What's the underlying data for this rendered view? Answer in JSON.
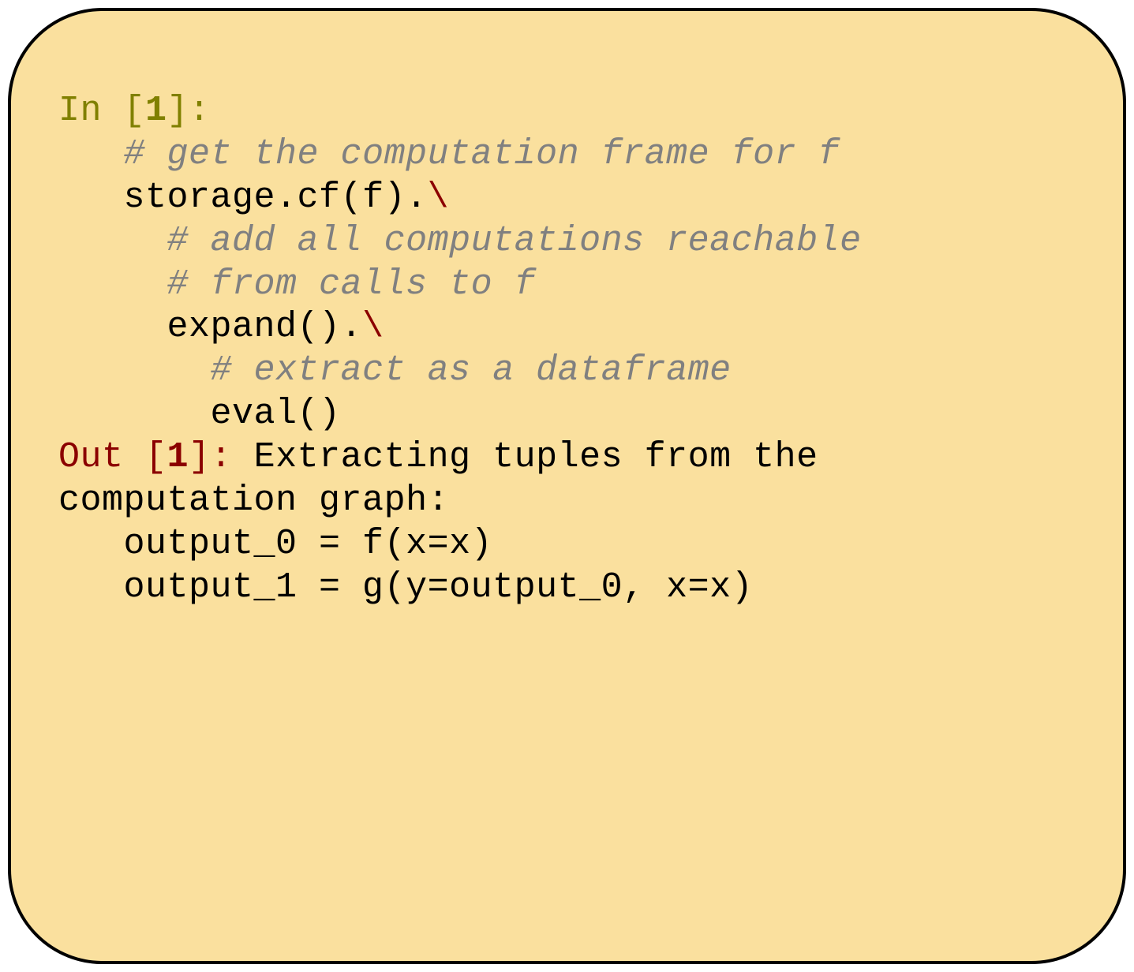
{
  "cell": {
    "in_label_prefix": "In [",
    "in_label_number": "1",
    "in_label_suffix": "]:",
    "out_label_prefix": "Out [",
    "out_label_number": "1",
    "out_label_suffix": "]:",
    "lines": {
      "comment1": "# get the computation frame for f",
      "code1": "storage.cf(f).",
      "backslash1": "\\",
      "comment2": "# add all computations reachable",
      "comment3": "# from calls to f",
      "code2": "expand().",
      "backslash2": "\\",
      "comment4": "# extract as a dataframe",
      "code3": "eval()",
      "out_text1": " Extracting tuples from the",
      "out_text2": "computation graph:",
      "out_text3": "   output_0 = f(x=x)",
      "out_text4": "   output_1 = g(y=output_0, x=x)"
    }
  }
}
